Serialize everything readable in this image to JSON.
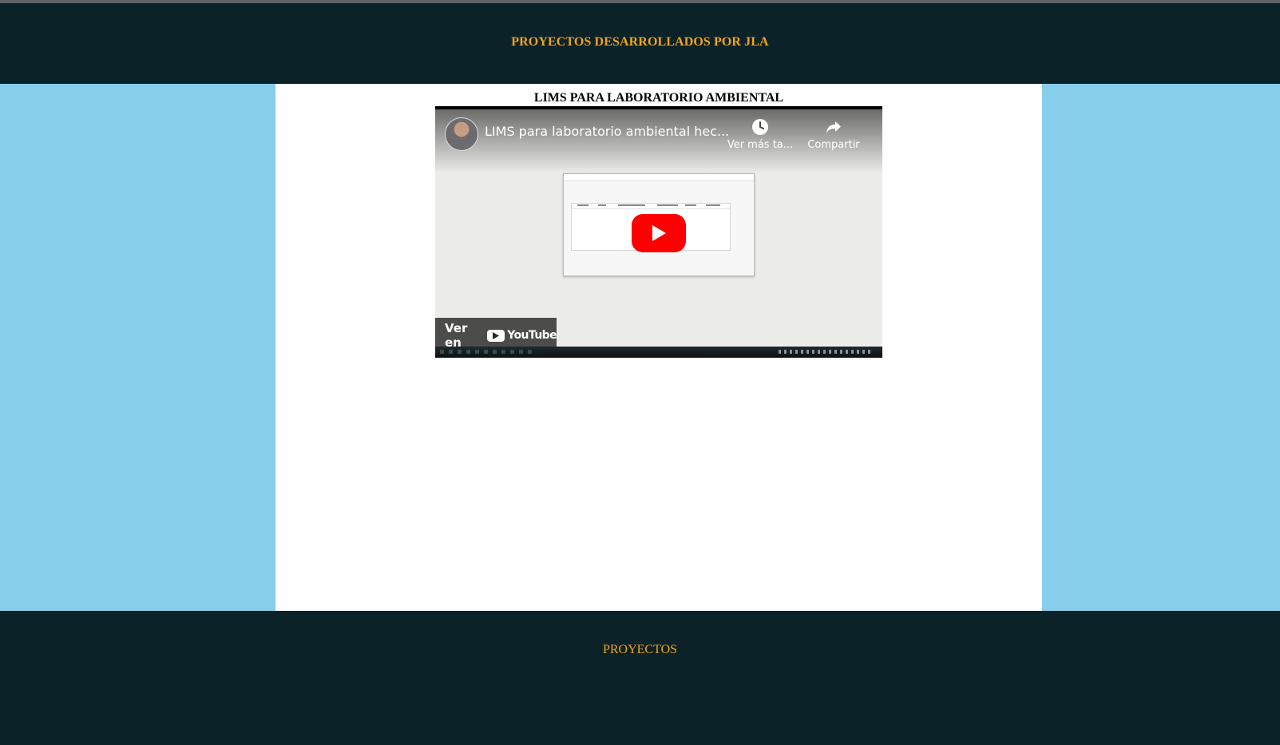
{
  "header": {
    "title": "PROYECTOS DESARROLLADOS POR JLA"
  },
  "project": {
    "title": "LIMS PARA LABORATORIO AMBIENTAL"
  },
  "video": {
    "title": "LIMS para laboratorio ambiental hec...",
    "watch_later_label": "Ver más ta...",
    "share_label": "Compartir",
    "watch_on_label": "Ver en",
    "platform_label": "YouTube",
    "play_color": "#ff0000"
  },
  "footer": {
    "link_label": "PROYECTOS"
  },
  "colors": {
    "dark_bg": "#0b2228",
    "accent": "#f3a41c",
    "side_bg": "#87ceeb",
    "panel_bg": "#ffffff"
  }
}
